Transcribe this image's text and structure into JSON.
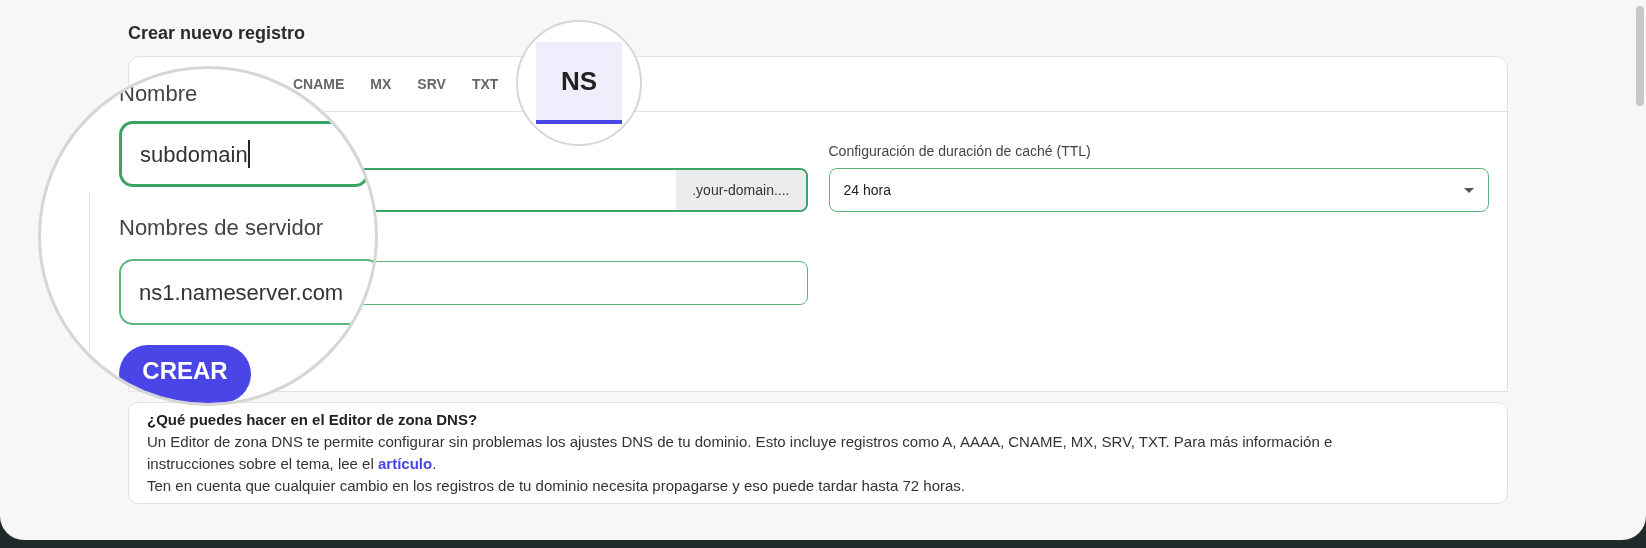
{
  "title": "Crear nuevo registro",
  "tabs": [
    {
      "label": "CNAME",
      "selected": false
    },
    {
      "label": "MX",
      "selected": false
    },
    {
      "label": "SRV",
      "selected": false
    },
    {
      "label": "TXT",
      "selected": false
    },
    {
      "label": "NS",
      "selected": true
    }
  ],
  "form": {
    "name_field": {
      "label": "Nombre",
      "value": "subdomain",
      "suffix": ".your-domain...."
    },
    "ttl_field": {
      "label": "Configuración de duración de caché (TTL)",
      "value": "24 hora"
    },
    "nameserver_field": {
      "label": "Nombres de servidor",
      "value": "ns1.nameserver.com"
    },
    "submit": "CREAR"
  },
  "info": {
    "heading": "¿Qué puedes hacer en el Editor de zona DNS?",
    "text_before_link": "Un Editor de zona DNS te permite configurar sin problemas los ajustes DNS de tu dominio. Esto incluye registros como A, AAAA, CNAME, MX, SRV, TXT. Para más información e instrucciones sobre el tema, lee el",
    "link": "artículo",
    "text_after_link": ".",
    "note": "Ten en cuenta que cualquier cambio en los registros de tu dominio necesita propagarse y eso puede tardar hasta 72 horas."
  }
}
